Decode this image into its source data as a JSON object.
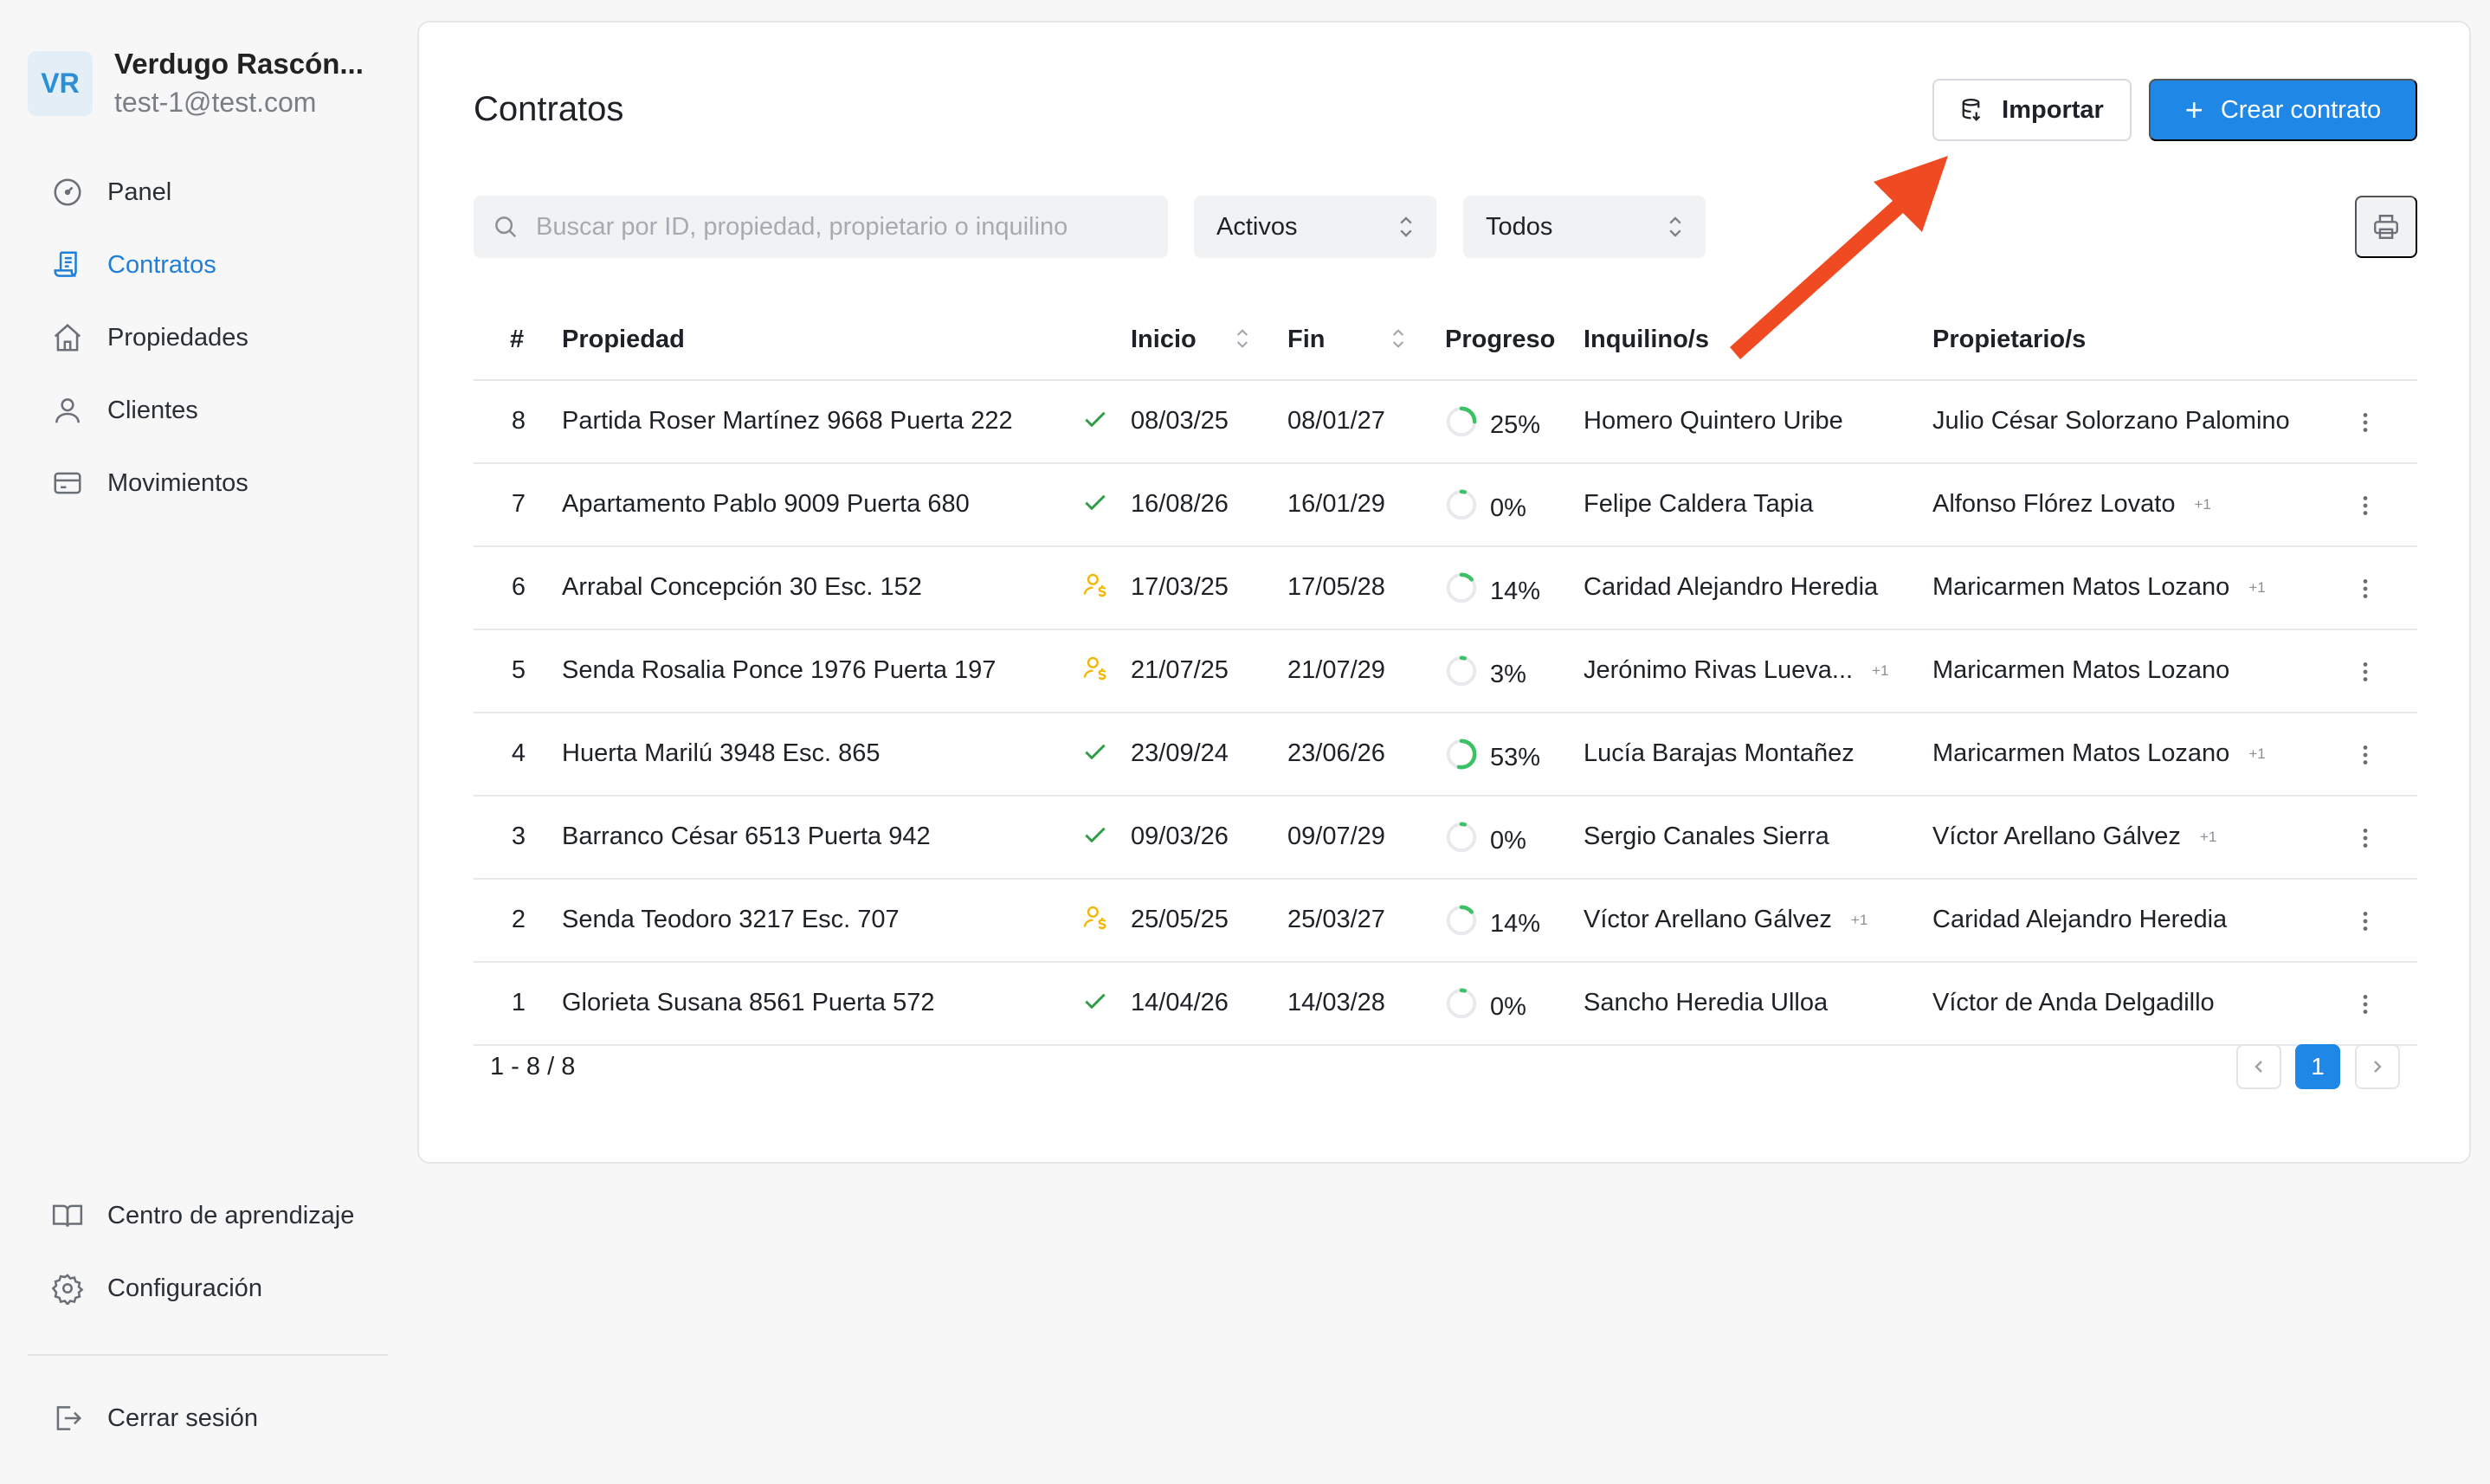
{
  "user": {
    "initials": "VR",
    "name": "Verdugo Rascón...",
    "email": "test-1@test.com"
  },
  "nav": [
    {
      "label": "Panel",
      "icon": "gauge-icon",
      "active": false
    },
    {
      "label": "Contratos",
      "icon": "contract-icon",
      "active": true
    },
    {
      "label": "Propiedades",
      "icon": "home-icon",
      "active": false
    },
    {
      "label": "Clientes",
      "icon": "user-icon",
      "active": false
    },
    {
      "label": "Movimientos",
      "icon": "card-icon",
      "active": false
    }
  ],
  "nav_bottom": [
    {
      "label": "Centro de aprendizaje",
      "icon": "book-icon"
    },
    {
      "label": "Configuración",
      "icon": "gear-icon"
    }
  ],
  "logout_label": "Cerrar sesión",
  "page": {
    "title": "Contratos",
    "import_label": "Importar",
    "create_label": "Crear contrato",
    "search_placeholder": "Buscar por ID, propiedad, propietario o inquilino",
    "filter_status": "Activos",
    "filter_type": "Todos"
  },
  "table": {
    "headers": {
      "num": "#",
      "prop": "Propiedad",
      "ini": "Inicio",
      "fin": "Fin",
      "prog": "Progreso",
      "inq": "Inquilino/s",
      "own": "Propietario/s"
    },
    "rows": [
      {
        "num": "8",
        "prop": "Partida Roser Martínez 9668 Puerta 222",
        "status": "check",
        "ini": "08/03/25",
        "fin": "08/01/27",
        "progress": 25,
        "prog_label": "25%",
        "inq": "Homero Quintero Uribe",
        "inq_extra": "",
        "own": "Julio César Solorzano Palomino",
        "own_extra": ""
      },
      {
        "num": "7",
        "prop": "Apartamento Pablo 9009 Puerta 680",
        "status": "check",
        "ini": "16/08/26",
        "fin": "16/01/29",
        "progress": 0,
        "prog_label": "0%",
        "inq": "Felipe Caldera Tapia",
        "inq_extra": "",
        "own": "Alfonso Flórez Lovato",
        "own_extra": "+1"
      },
      {
        "num": "6",
        "prop": "Arrabal Concepción 30 Esc. 152",
        "status": "pending",
        "ini": "17/03/25",
        "fin": "17/05/28",
        "progress": 14,
        "prog_label": "14%",
        "inq": "Caridad Alejandro Heredia",
        "inq_extra": "",
        "own": "Maricarmen Matos Lozano",
        "own_extra": "+1"
      },
      {
        "num": "5",
        "prop": "Senda Rosalia Ponce 1976 Puerta 197",
        "status": "pending",
        "ini": "21/07/25",
        "fin": "21/07/29",
        "progress": 3,
        "prog_label": "3%",
        "inq": "Jerónimo Rivas Lueva...",
        "inq_extra": "+1",
        "own": "Maricarmen Matos Lozano",
        "own_extra": ""
      },
      {
        "num": "4",
        "prop": "Huerta Marilú 3948 Esc. 865",
        "status": "check",
        "ini": "23/09/24",
        "fin": "23/06/26",
        "progress": 53,
        "prog_label": "53%",
        "inq": "Lucía Barajas Montañez",
        "inq_extra": "",
        "own": "Maricarmen Matos Lozano",
        "own_extra": "+1"
      },
      {
        "num": "3",
        "prop": "Barranco César 6513 Puerta 942",
        "status": "check",
        "ini": "09/03/26",
        "fin": "09/07/29",
        "progress": 0,
        "prog_label": "0%",
        "inq": "Sergio Canales Sierra",
        "inq_extra": "",
        "own": "Víctor Arellano Gálvez",
        "own_extra": "+1"
      },
      {
        "num": "2",
        "prop": "Senda Teodoro 3217 Esc. 707",
        "status": "pending",
        "ini": "25/05/25",
        "fin": "25/03/27",
        "progress": 14,
        "prog_label": "14%",
        "inq": "Víctor Arellano Gálvez",
        "inq_extra": "+1",
        "own": "Caridad Alejandro Heredia",
        "own_extra": ""
      },
      {
        "num": "1",
        "prop": "Glorieta Susana 8561 Puerta 572",
        "status": "check",
        "ini": "14/04/26",
        "fin": "14/03/28",
        "progress": 0,
        "prog_label": "0%",
        "inq": "Sancho Heredia Ulloa",
        "inq_extra": "",
        "own": "Víctor de Anda Delgadillo",
        "own_extra": ""
      }
    ]
  },
  "pagination": {
    "info": "1 - 8 / 8",
    "current": "1"
  },
  "colors": {
    "accent": "#1f87e5",
    "check": "#2f9e44",
    "pending": "#f2b705",
    "progress": "#3cc266",
    "arrow": "#f04a23"
  }
}
